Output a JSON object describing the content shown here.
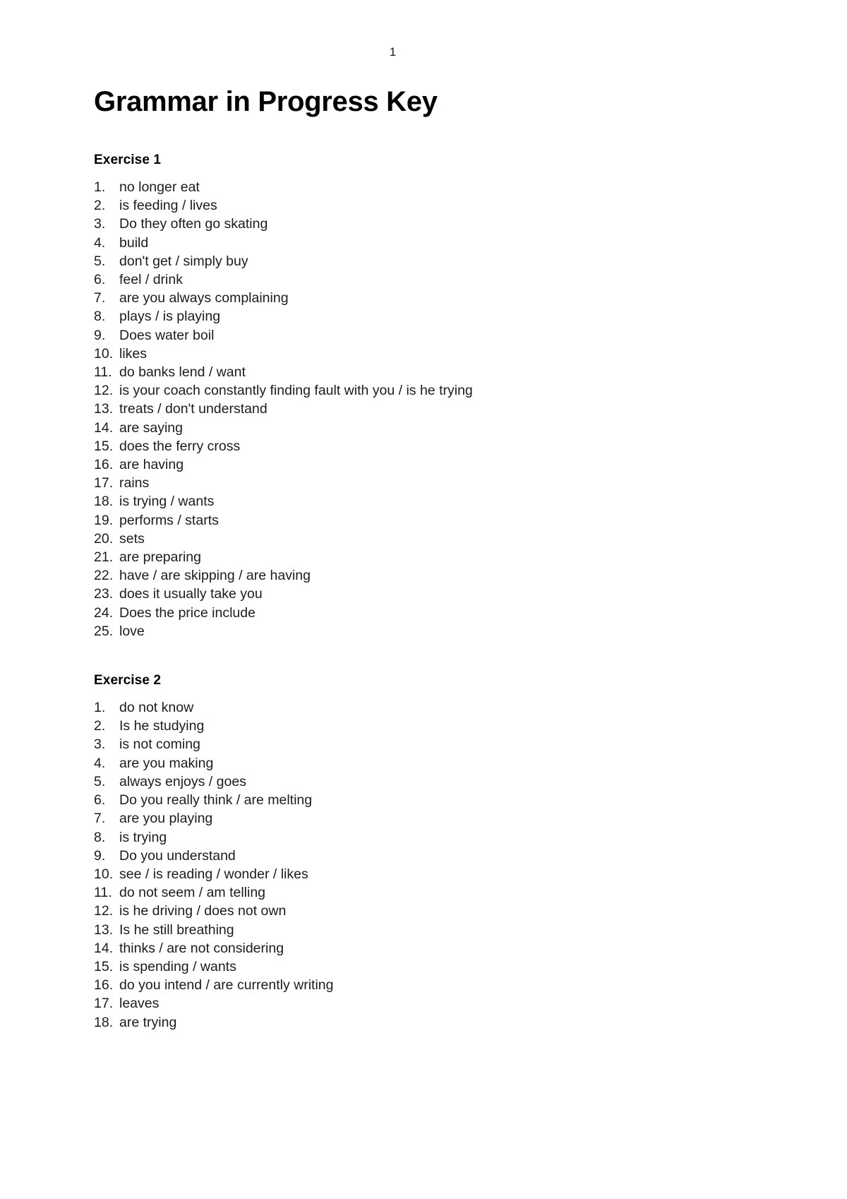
{
  "page": {
    "number": "1",
    "title": "Grammar in Progress Key"
  },
  "sections": [
    {
      "heading": "Exercise 1",
      "items": [
        {
          "num": "1.",
          "text": "no longer eat"
        },
        {
          "num": "2.",
          "text": "is feeding / lives"
        },
        {
          "num": "3.",
          "text": "Do they often go skating"
        },
        {
          "num": "4.",
          "text": "build"
        },
        {
          "num": "5.",
          "text": "don't get / simply buy"
        },
        {
          "num": "6.",
          "text": "feel / drink"
        },
        {
          "num": "7.",
          "text": "are you always complaining"
        },
        {
          "num": "8.",
          "text": "plays / is playing"
        },
        {
          "num": "9.",
          "text": "Does water boil"
        },
        {
          "num": "10.",
          "text": "likes"
        },
        {
          "num": "11.",
          "text": "do banks lend / want"
        },
        {
          "num": "12.",
          "text": "is your coach constantly finding fault with you / is he trying"
        },
        {
          "num": "13.",
          "text": "treats / don't understand"
        },
        {
          "num": "14.",
          "text": "are saying"
        },
        {
          "num": "15.",
          "text": "does the ferry cross"
        },
        {
          "num": "16.",
          "text": "are having"
        },
        {
          "num": "17.",
          "text": "rains"
        },
        {
          "num": "18.",
          "text": "is trying / wants"
        },
        {
          "num": "19.",
          "text": "performs / starts"
        },
        {
          "num": "20.",
          "text": "sets"
        },
        {
          "num": "21.",
          "text": "are preparing"
        },
        {
          "num": "22.",
          "text": "have / are skipping / are having"
        },
        {
          "num": "23.",
          "text": "does it usually take you"
        },
        {
          "num": "24.",
          "text": "Does the price include"
        },
        {
          "num": "25.",
          "text": "love"
        }
      ]
    },
    {
      "heading": "Exercise 2",
      "items": [
        {
          "num": "1.",
          "text": "do not know"
        },
        {
          "num": "2.",
          "text": "Is he studying"
        },
        {
          "num": "3.",
          "text": "is not coming"
        },
        {
          "num": "4.",
          "text": "are you making"
        },
        {
          "num": "5.",
          "text": "always enjoys / goes"
        },
        {
          "num": "6.",
          "text": "Do you really think / are melting"
        },
        {
          "num": "7.",
          "text": "are you playing"
        },
        {
          "num": "8.",
          "text": "is trying"
        },
        {
          "num": "9.",
          "text": "Do you understand"
        },
        {
          "num": "10.",
          "text": "see / is reading / wonder / likes"
        },
        {
          "num": "11.",
          "text": "do not seem / am telling"
        },
        {
          "num": "12.",
          "text": "is he driving / does not own"
        },
        {
          "num": "13.",
          "text": "Is he still breathing"
        },
        {
          "num": "14.",
          "text": "thinks / are not considering"
        },
        {
          "num": "15.",
          "text": "is spending / wants"
        },
        {
          "num": "16.",
          "text": "do you intend / are currently writing"
        },
        {
          "num": "17.",
          "text": "leaves"
        },
        {
          "num": "18.",
          "text": "are trying"
        }
      ]
    }
  ]
}
